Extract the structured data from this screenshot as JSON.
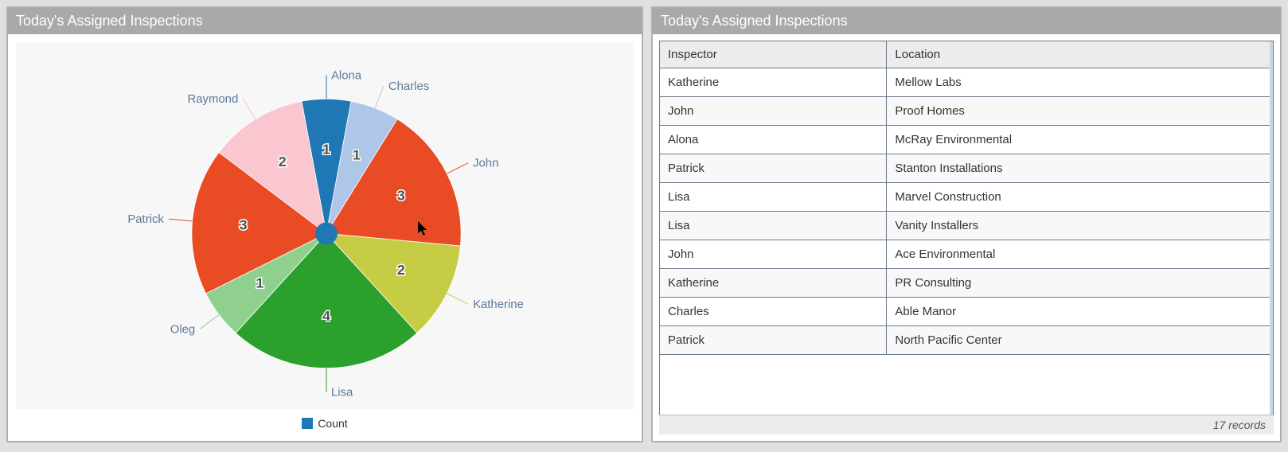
{
  "chart_panel": {
    "title": "Today's Assigned Inspections",
    "legend_label": "Count"
  },
  "chart_data": {
    "type": "pie",
    "title": "Today's Assigned Inspections",
    "series": [
      {
        "name": "Alona",
        "value": 1,
        "color": "#1f77b4"
      },
      {
        "name": "Charles",
        "value": 1,
        "color": "#aec7e8"
      },
      {
        "name": "John",
        "value": 3,
        "color": "#e94b24"
      },
      {
        "name": "Katherine",
        "value": 2,
        "color": "#c6cd45"
      },
      {
        "name": "Lisa",
        "value": 4,
        "color": "#2ca02c"
      },
      {
        "name": "Oleg",
        "value": 1,
        "color": "#8fd08f"
      },
      {
        "name": "Patrick",
        "value": 3,
        "color": "#e94b24"
      },
      {
        "name": "Raymond",
        "value": 2,
        "color": "#fac6cf"
      }
    ],
    "legend": [
      "Count"
    ]
  },
  "table_panel": {
    "title": "Today's Assigned Inspections",
    "columns": [
      "Inspector",
      "Location"
    ],
    "rows": [
      {
        "inspector": "Katherine",
        "location": "Mellow Labs"
      },
      {
        "inspector": "John",
        "location": "Proof Homes"
      },
      {
        "inspector": "Alona",
        "location": "McRay Environmental"
      },
      {
        "inspector": "Patrick",
        "location": "Stanton Installations"
      },
      {
        "inspector": "Lisa",
        "location": "Marvel Construction"
      },
      {
        "inspector": "Lisa",
        "location": "Vanity Installers"
      },
      {
        "inspector": "John",
        "location": "Ace Environmental"
      },
      {
        "inspector": "Katherine",
        "location": "PR Consulting"
      },
      {
        "inspector": "Charles",
        "location": "Able Manor"
      },
      {
        "inspector": "Patrick",
        "location": "North Pacific Center"
      }
    ],
    "footer": "17 records"
  },
  "colors": {
    "header_bg": "#a9a9a9",
    "legend_swatch": "#1f77b4"
  }
}
